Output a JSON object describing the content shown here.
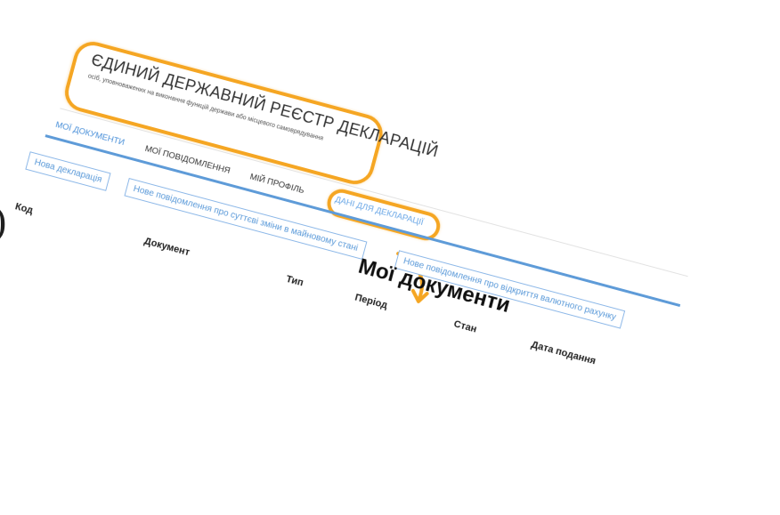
{
  "fragment_text": ").",
  "header": {
    "title": "ЄДИНИЙ ДЕРЖАВНИЙ РЕЄСТР ДЕКЛАРАЦІЙ",
    "subtitle": "осіб, уповноважених на виконання функцій держави або місцевого самоврядування"
  },
  "tabs": [
    {
      "label": "МОЇ ДОКУМЕНТИ"
    },
    {
      "label": "МОЇ ПОВІДОМЛЕННЯ"
    },
    {
      "label": "МІЙ ПРОФІЛЬ"
    },
    {
      "label": "ДАНІ ДЛЯ ДЕКЛАРАЦІЇ"
    }
  ],
  "buttons": {
    "new_declaration": "Нова декларація",
    "property_change": "Нове повідомлення про суттєві зміни в майновому стані",
    "currency_account": "Нове повідомлення про відкриття валютного рахунку"
  },
  "page_title": "Мої документи",
  "table": {
    "columns": [
      "Код",
      "Документ",
      "Тип",
      "Період",
      "Стан",
      "Дата подання"
    ]
  },
  "colors": {
    "highlight": "#f5a623",
    "accent": "#4a90d9",
    "tab_line": "#5e9bd8"
  }
}
